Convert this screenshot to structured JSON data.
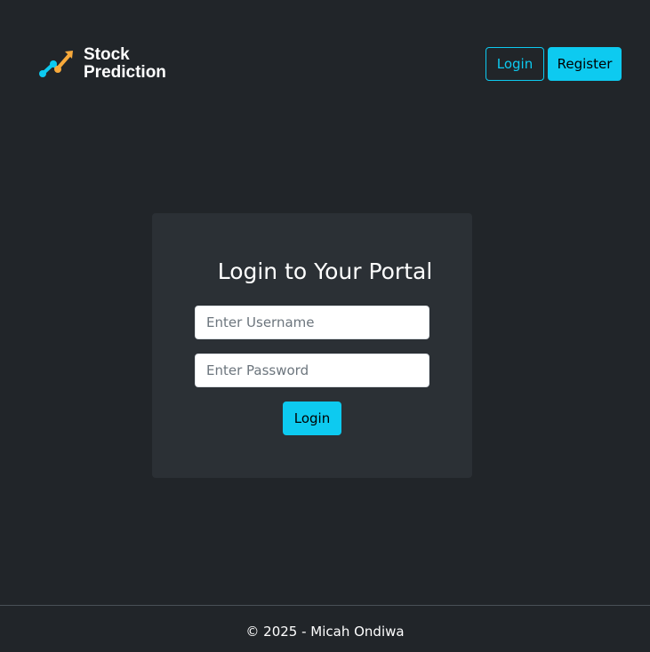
{
  "brand": {
    "line1": "Stock",
    "line2": "Prediction"
  },
  "nav": {
    "login_label": "Login",
    "register_label": "Register"
  },
  "login_card": {
    "title": "Login to Your Portal",
    "username_placeholder": "Enter Username",
    "password_placeholder": "Enter Password",
    "submit_label": "Login"
  },
  "footer": {
    "text": "© 2025 - Micah Ondiwa"
  },
  "colors": {
    "background": "#212529",
    "card": "#2b3035",
    "accent": "#0dcaf0",
    "logo_orange": "#f7a93b"
  },
  "icons": {
    "logo": "trend-up-chart-icon"
  }
}
